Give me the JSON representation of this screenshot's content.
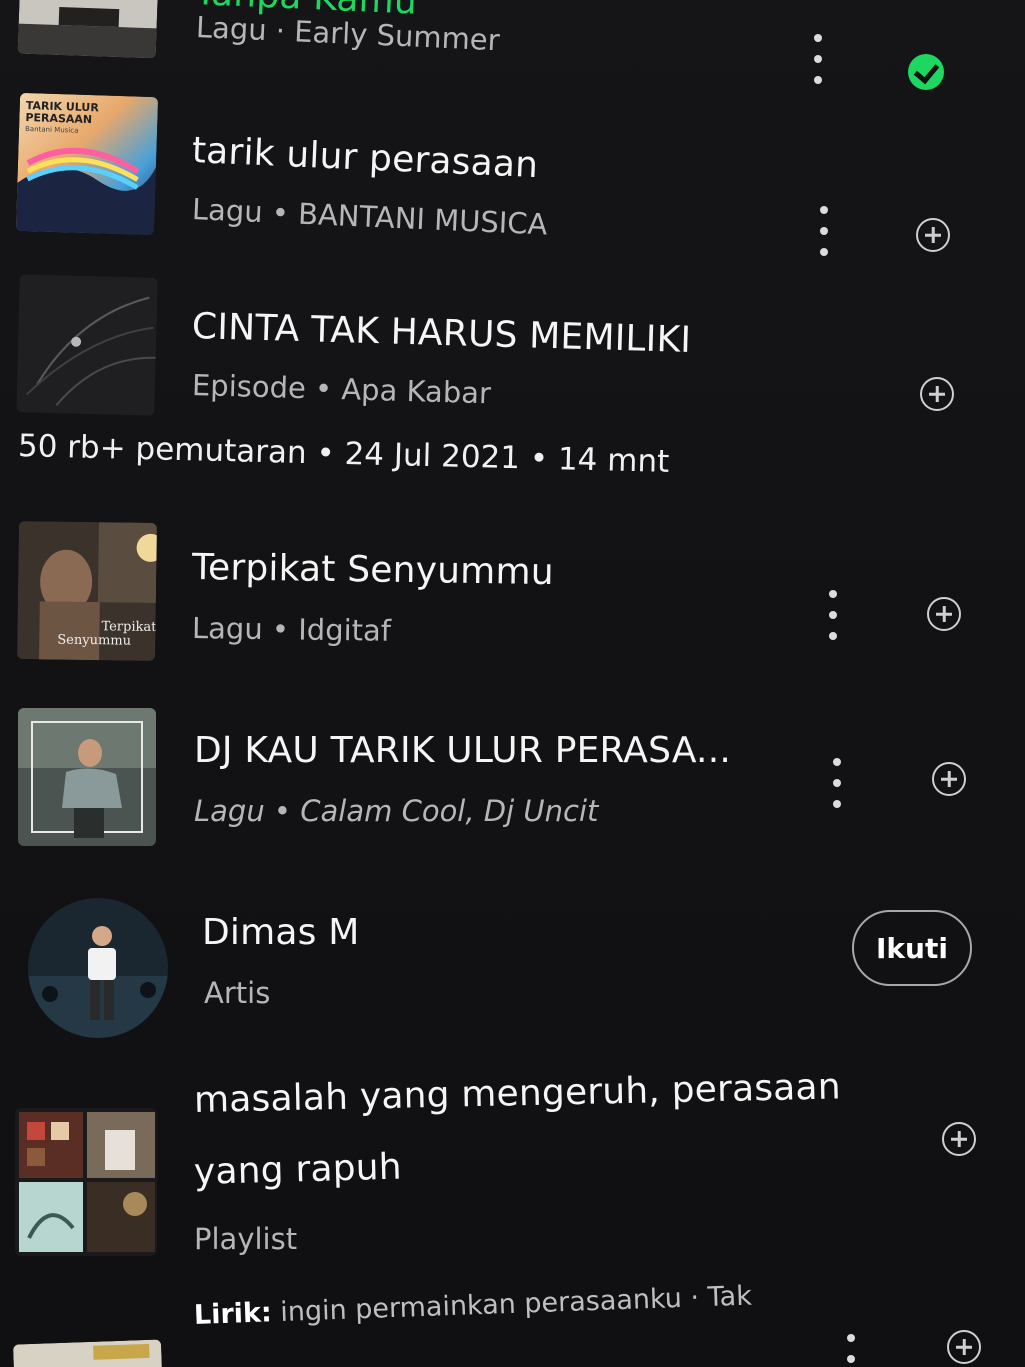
{
  "items": [
    {
      "title": "Tanpa Kamu",
      "subtitle": "Lagu · Early Summer",
      "icon": "check-circle-icon",
      "accent": "#1ed760"
    },
    {
      "title": "tarik ulur perasaan",
      "subtitle": "Lagu • BANTANI MUSICA",
      "art_text_1": "TARIK ULUR",
      "art_text_2": "PERASAAN",
      "art_text_3": "Bantani Musica",
      "icon": "add-circle-icon"
    },
    {
      "title": "CINTA TAK HARUS MEMILIKI",
      "subtitle": "Episode • Apa Kabar",
      "stats": "50 rb+ pemutaran • 24 Jul 2021 • 14 mnt",
      "icon": "add-circle-icon"
    },
    {
      "title": "Terpikat Senyummu",
      "subtitle": "Lagu • Idgitaf",
      "art_text_1": "Terpikat",
      "art_text_2": "Senyummu",
      "icon": "add-circle-icon"
    },
    {
      "title": "DJ KAU TARIK ULUR PERASA...",
      "subtitle": "Lagu • Calam Cool, Dj Uncit",
      "icon": "add-circle-icon"
    },
    {
      "title": "Dimas M",
      "subtitle": "Artis",
      "follow_label": "Ikuti"
    },
    {
      "title_line_1": "masalah yang mengeruh, perasaan",
      "title_line_2": "yang rapuh",
      "subtitle": "Playlist",
      "icon": "add-circle-icon"
    },
    {
      "lyrics_label": "Lirik:",
      "lyrics_text": "ingin permainkan perasaanku · Tak",
      "icon": "add-circle-icon"
    }
  ]
}
